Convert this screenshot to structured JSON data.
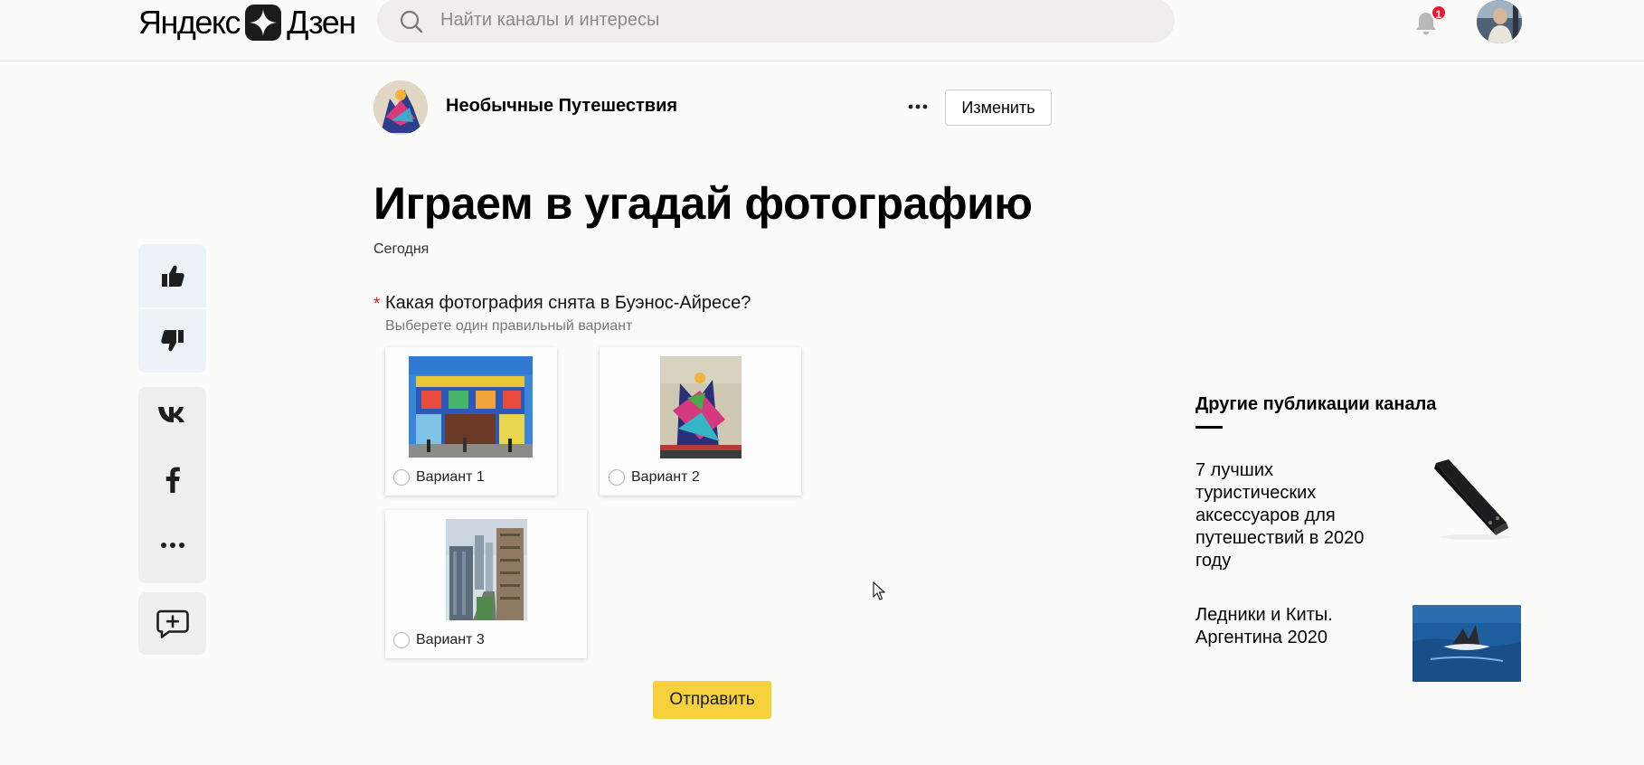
{
  "header": {
    "logo_left": "Яндекс",
    "logo_right": "Дзен",
    "search_placeholder": "Найти каналы и интересы",
    "notification_count": "1"
  },
  "channel": {
    "name": "Необычные Путешествия",
    "edit_label": "Изменить"
  },
  "article": {
    "title": "Играем в угадай фотографию",
    "date": "Сегодня"
  },
  "quiz": {
    "required_mark": "*",
    "question": "Какая фотография снята в Буэнос-Айресе?",
    "hint": "Выберете один правильный вариант",
    "options": [
      {
        "label": "Вариант 1"
      },
      {
        "label": "Вариант 2"
      },
      {
        "label": "Вариант 3"
      }
    ],
    "submit_label": "Отправить"
  },
  "sidebar": {
    "title": "Другие публикации канала",
    "publications": [
      {
        "title": "7 лучших туристических аксессуаров для путешествий в 2020 году"
      },
      {
        "title": "Ледники и Киты. Аргентина 2020"
      }
    ]
  },
  "colors": {
    "accent_yellow": "#f6d13c",
    "badge_red": "#f0162f",
    "like_panel": "#ecf2f8"
  }
}
